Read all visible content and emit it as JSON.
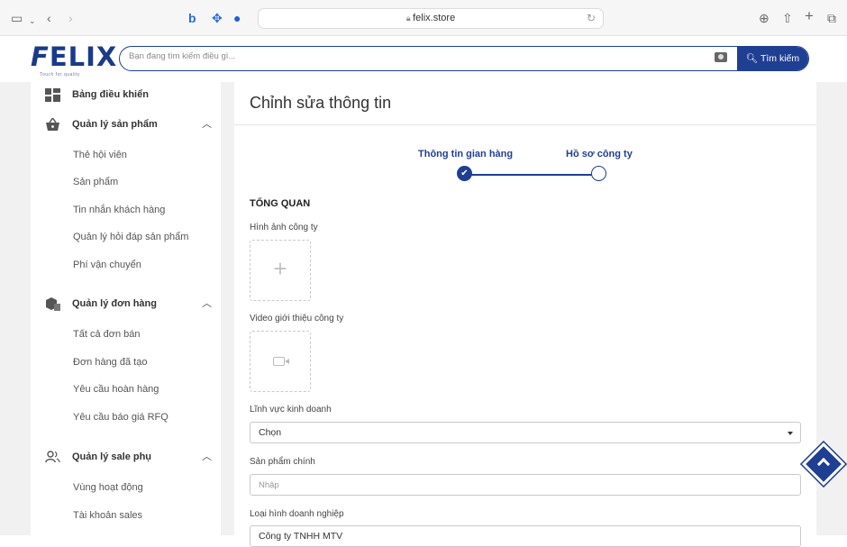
{
  "browser": {
    "url": "felix.store",
    "lock_icon": "lock-icon"
  },
  "header": {
    "logo_word": "ELIX",
    "logo_letter": "F",
    "logo_tagline": "Touch for quality",
    "search_placeholder": "Bạn đang tìm kiếm điều gì...",
    "search_button": "Tìm kiếm"
  },
  "sidebar": {
    "dashboard": "Bảng điều khiển",
    "products_section": {
      "label": "Quản lý sản phẩm",
      "items": [
        "Thẻ hội viên",
        "Sản phẩm",
        "Tin nhắn khách hàng",
        "Quản lý hỏi đáp sản phẩm",
        "Phí vận chuyển"
      ]
    },
    "orders_section": {
      "label": "Quản lý đơn hàng",
      "items": [
        "Tất cả đơn bán",
        "Đơn hàng đã tạo",
        "Yêu cầu hoàn hàng",
        "Yêu cầu báo giá RFQ"
      ]
    },
    "sales_section": {
      "label": "Quản lý sale phụ",
      "items": [
        "Vùng hoạt động",
        "Tài khoản sales"
      ]
    }
  },
  "main": {
    "title": "Chỉnh sửa thông tin",
    "steps": [
      "Thông tin gian hàng",
      "Hồ sơ công ty"
    ],
    "overview": "TỔNG QUAN",
    "company_image_label": "Hình ảnh công ty",
    "company_video_label": "Video giới thiệu công ty",
    "business_field_label": "Lĩnh vực kinh doanh",
    "business_field_value": "Chọn",
    "main_product_label": "Sản phẩm chính",
    "main_product_placeholder": "Nhập",
    "business_type_label": "Loại hình doanh nghiệp",
    "business_type_value": "Công ty TNHH MTV"
  },
  "colors": {
    "brand": "#1f3f93"
  }
}
